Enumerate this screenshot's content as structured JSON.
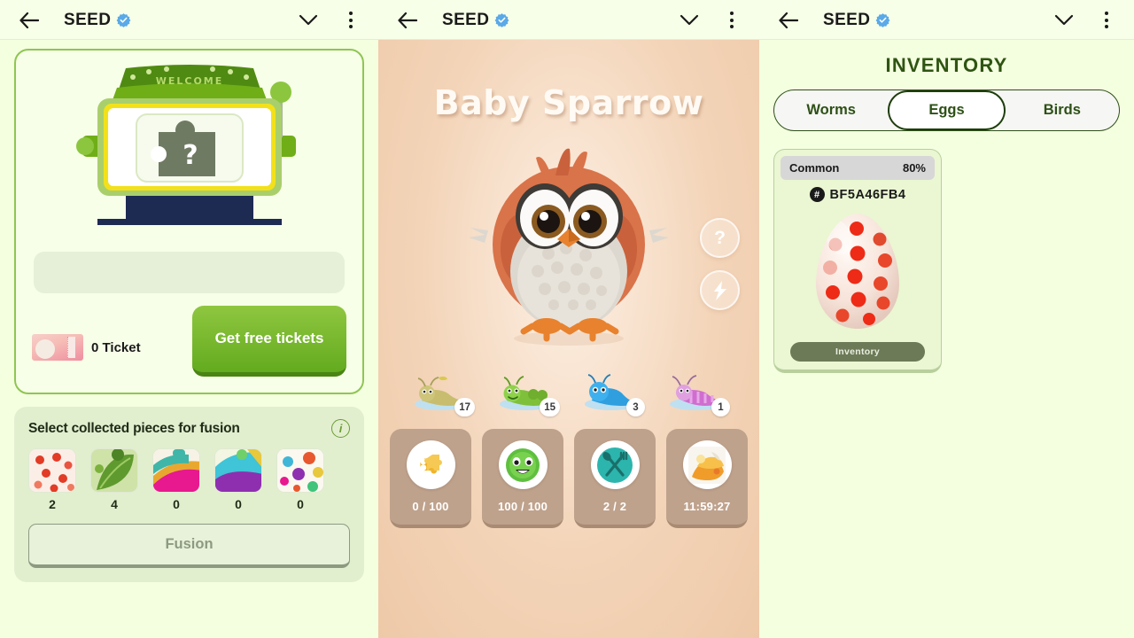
{
  "app": {
    "title": "SEED",
    "verified": true,
    "icons": {
      "back": "back-arrow-icon",
      "chevron": "chevron-down-icon",
      "menu": "more-vertical-icon"
    }
  },
  "gacha": {
    "machine_banner": "WELCOME",
    "machine_symbol": "?",
    "ticket_count_label": "0 Ticket",
    "free_tickets_button": "Get free tickets"
  },
  "fusion": {
    "title": "Select collected pieces for fusion",
    "info_icon": "i",
    "button_label": "Fusion",
    "pieces": [
      {
        "name": "egg-piece",
        "count": "2"
      },
      {
        "name": "leaf-piece",
        "count": "4"
      },
      {
        "name": "wave-piece",
        "count": "0"
      },
      {
        "name": "aurora-piece",
        "count": "0"
      },
      {
        "name": "splash-piece",
        "count": "0"
      }
    ]
  },
  "pet": {
    "name": "Baby Sparrow",
    "help_button": "?",
    "boost_button": "⚡",
    "worms": [
      {
        "name": "yellow-worm",
        "count": "17"
      },
      {
        "name": "green-worm",
        "count": "15"
      },
      {
        "name": "blue-worm",
        "count": "3"
      },
      {
        "name": "purple-worm",
        "count": "1"
      }
    ],
    "stats": [
      {
        "name": "xp",
        "icon": "puzzle-icon",
        "value": "0 / 100"
      },
      {
        "name": "health",
        "icon": "happy-face-icon",
        "value": "100 / 100"
      },
      {
        "name": "feed",
        "icon": "spoon-fork-icon",
        "value": "2 / 2"
      },
      {
        "name": "reward-timer",
        "icon": "treasure-icon",
        "value": "11:59:27"
      }
    ]
  },
  "inventory": {
    "title": "INVENTORY",
    "tabs": [
      {
        "label": "Worms",
        "active": false
      },
      {
        "label": "Eggs",
        "active": true
      },
      {
        "label": "Birds",
        "active": false
      }
    ],
    "items": [
      {
        "rarity": "Common",
        "percent": "80%",
        "hash_symbol": "#",
        "id": "BF5A46FB4",
        "art": "red-dotted-egg",
        "action_label": "Inventory"
      }
    ]
  },
  "colors": {
    "page_green": "#f4ffe0",
    "pet_bg": "#f0cdae",
    "accent_green": "#63ab1f",
    "dark_green": "#2d5016",
    "verified_blue": "#1d9bf0"
  }
}
